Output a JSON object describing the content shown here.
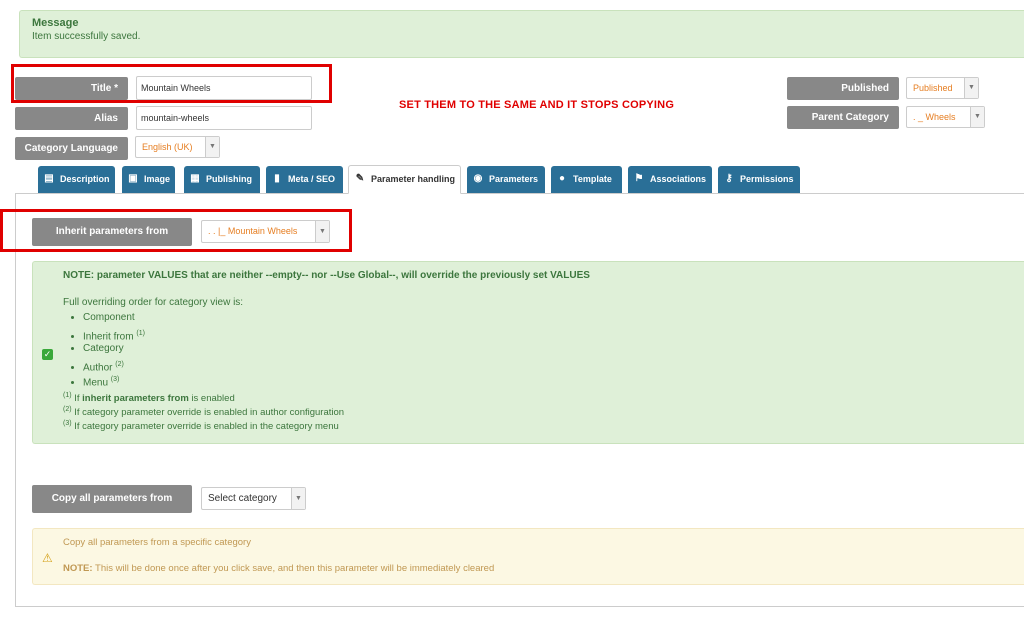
{
  "message": {
    "title": "Message",
    "body": "Item successfully saved."
  },
  "form": {
    "title_label": "Title *",
    "title_value": "Mountain Wheels",
    "alias_label": "Alias",
    "alias_value": "mountain-wheels",
    "language_label": "Category Language",
    "language_value": "English (UK)",
    "published_label": "Published",
    "published_value": "Published",
    "parent_label": "Parent Category",
    "parent_value": ". _ Wheels"
  },
  "annotation": "SET THEM TO THE SAME AND IT STOPS COPYING",
  "tabs": [
    {
      "label": "Description",
      "icon": "document-icon"
    },
    {
      "label": "Image",
      "icon": "image-icon"
    },
    {
      "label": "Publishing",
      "icon": "calendar-icon"
    },
    {
      "label": "Meta / SEO",
      "icon": "bookmark-icon"
    },
    {
      "label": "Parameter handling",
      "icon": "wrench-icon"
    },
    {
      "label": "Parameters",
      "icon": "eye-icon"
    },
    {
      "label": "Template",
      "icon": "palette-icon"
    },
    {
      "label": "Associations",
      "icon": "flag-icon"
    },
    {
      "label": "Permissions",
      "icon": "key-icon"
    }
  ],
  "inherit": {
    "label": "Inherit parameters from",
    "value": ". . |_ Mountain Wheels"
  },
  "note": {
    "heading": "NOTE: parameter VALUES that are neither --empty-- nor --Use Global--, will override the previously set VALUES",
    "intro": "Full overriding order for category view is:",
    "items": [
      "Component",
      "Inherit from",
      "Category",
      "Author",
      "Menu"
    ],
    "item_sups": [
      "",
      "(1)",
      "",
      "(2)",
      "(3)"
    ],
    "footnotes": [
      {
        "sup": "(1)",
        "pre": " If ",
        "bold": "inherit parameters from",
        "post": " is enabled"
      },
      {
        "sup": "(2)",
        "pre": " If category parameter override is enabled in author configuration",
        "bold": "",
        "post": ""
      },
      {
        "sup": "(3)",
        "pre": " If category parameter override is enabled in the category menu",
        "bold": "",
        "post": ""
      }
    ]
  },
  "copy": {
    "label": "Copy all parameters from",
    "select_value": "Select category",
    "info_line1": "Copy all parameters from a specific category",
    "info_note_bold": "NOTE:",
    "info_note_rest": " This will be done once after you click save, and then this parameter will be immediately cleared"
  },
  "colors": {
    "tab_blue": "#2a6f97",
    "label_grey": "#888888",
    "success_bg": "#dff0d8",
    "warning_bg": "#fcf8e3",
    "annotation_red": "#e00000",
    "select_orange": "#e67e22"
  }
}
